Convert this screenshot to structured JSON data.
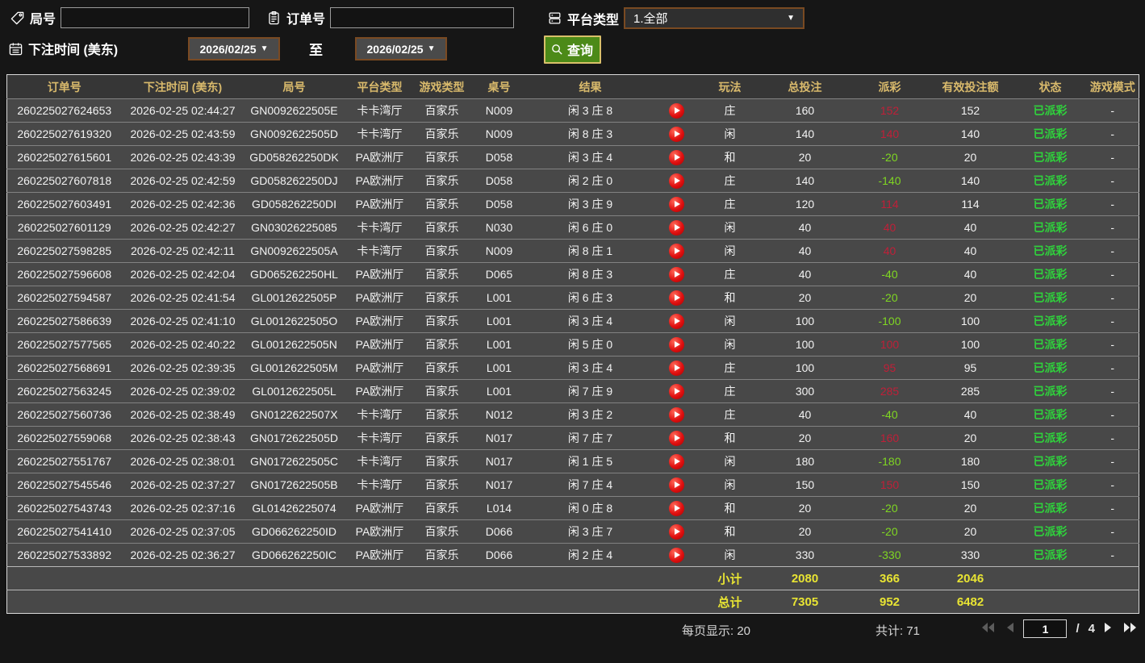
{
  "filter_bar": {
    "game_no": {
      "label": "局号",
      "value": ""
    },
    "order_no": {
      "label": "订单号",
      "value": ""
    },
    "platform_type": {
      "label": "平台类型",
      "value": "1.全部"
    },
    "bet_time": {
      "label": "下注时间 (美东)"
    },
    "date_from": "2026/02/25",
    "to_label": "至",
    "date_to": "2026/02/25",
    "search_button": "查询"
  },
  "table": {
    "headers": [
      "订单号",
      "下注时间 (美东)",
      "局号",
      "平台类型",
      "游戏类型",
      "桌号",
      "结果",
      "",
      "玩法",
      "总投注",
      "派彩",
      "有效投注额",
      "状态",
      "游戏模式"
    ],
    "rows": [
      {
        "order": "260225027624653",
        "time": "2026-02-25 02:44:27",
        "game_no": "GN0092622505E",
        "platform": "卡卡湾厅",
        "game_type": "百家乐",
        "table_no": "N009",
        "result": "闲 3 庄 8",
        "play": "庄",
        "total_bet": "160",
        "payout": "152",
        "valid_bet": "152",
        "status": "已派彩",
        "mode": "-"
      },
      {
        "order": "260225027619320",
        "time": "2026-02-25 02:43:59",
        "game_no": "GN0092622505D",
        "platform": "卡卡湾厅",
        "game_type": "百家乐",
        "table_no": "N009",
        "result": "闲 8 庄 3",
        "play": "闲",
        "total_bet": "140",
        "payout": "140",
        "valid_bet": "140",
        "status": "已派彩",
        "mode": "-"
      },
      {
        "order": "260225027615601",
        "time": "2026-02-25 02:43:39",
        "game_no": "GD058262250DK",
        "platform": "PA欧洲厅",
        "game_type": "百家乐",
        "table_no": "D058",
        "result": "闲 3 庄 4",
        "play": "和",
        "total_bet": "20",
        "payout": "-20",
        "valid_bet": "20",
        "status": "已派彩",
        "mode": "-"
      },
      {
        "order": "260225027607818",
        "time": "2026-02-25 02:42:59",
        "game_no": "GD058262250DJ",
        "platform": "PA欧洲厅",
        "game_type": "百家乐",
        "table_no": "D058",
        "result": "闲 2 庄 0",
        "play": "庄",
        "total_bet": "140",
        "payout": "-140",
        "valid_bet": "140",
        "status": "已派彩",
        "mode": "-"
      },
      {
        "order": "260225027603491",
        "time": "2026-02-25 02:42:36",
        "game_no": "GD058262250DI",
        "platform": "PA欧洲厅",
        "game_type": "百家乐",
        "table_no": "D058",
        "result": "闲 3 庄 9",
        "play": "庄",
        "total_bet": "120",
        "payout": "114",
        "valid_bet": "114",
        "status": "已派彩",
        "mode": "-"
      },
      {
        "order": "260225027601129",
        "time": "2026-02-25 02:42:27",
        "game_no": "GN03026225085",
        "platform": "卡卡湾厅",
        "game_type": "百家乐",
        "table_no": "N030",
        "result": "闲 6 庄 0",
        "play": "闲",
        "total_bet": "40",
        "payout": "40",
        "valid_bet": "40",
        "status": "已派彩",
        "mode": "-"
      },
      {
        "order": "260225027598285",
        "time": "2026-02-25 02:42:11",
        "game_no": "GN0092622505A",
        "platform": "卡卡湾厅",
        "game_type": "百家乐",
        "table_no": "N009",
        "result": "闲 8 庄 1",
        "play": "闲",
        "total_bet": "40",
        "payout": "40",
        "valid_bet": "40",
        "status": "已派彩",
        "mode": "-"
      },
      {
        "order": "260225027596608",
        "time": "2026-02-25 02:42:04",
        "game_no": "GD065262250HL",
        "platform": "PA欧洲厅",
        "game_type": "百家乐",
        "table_no": "D065",
        "result": "闲 8 庄 3",
        "play": "庄",
        "total_bet": "40",
        "payout": "-40",
        "valid_bet": "40",
        "status": "已派彩",
        "mode": "-"
      },
      {
        "order": "260225027594587",
        "time": "2026-02-25 02:41:54",
        "game_no": "GL0012622505P",
        "platform": "PA欧洲厅",
        "game_type": "百家乐",
        "table_no": "L001",
        "result": "闲 6 庄 3",
        "play": "和",
        "total_bet": "20",
        "payout": "-20",
        "valid_bet": "20",
        "status": "已派彩",
        "mode": "-"
      },
      {
        "order": "260225027586639",
        "time": "2026-02-25 02:41:10",
        "game_no": "GL0012622505O",
        "platform": "PA欧洲厅",
        "game_type": "百家乐",
        "table_no": "L001",
        "result": "闲 3 庄 4",
        "play": "闲",
        "total_bet": "100",
        "payout": "-100",
        "valid_bet": "100",
        "status": "已派彩",
        "mode": "-"
      },
      {
        "order": "260225027577565",
        "time": "2026-02-25 02:40:22",
        "game_no": "GL0012622505N",
        "platform": "PA欧洲厅",
        "game_type": "百家乐",
        "table_no": "L001",
        "result": "闲 5 庄 0",
        "play": "闲",
        "total_bet": "100",
        "payout": "100",
        "valid_bet": "100",
        "status": "已派彩",
        "mode": "-"
      },
      {
        "order": "260225027568691",
        "time": "2026-02-25 02:39:35",
        "game_no": "GL0012622505M",
        "platform": "PA欧洲厅",
        "game_type": "百家乐",
        "table_no": "L001",
        "result": "闲 3 庄 4",
        "play": "庄",
        "total_bet": "100",
        "payout": "95",
        "valid_bet": "95",
        "status": "已派彩",
        "mode": "-"
      },
      {
        "order": "260225027563245",
        "time": "2026-02-25 02:39:02",
        "game_no": "GL0012622505L",
        "platform": "PA欧洲厅",
        "game_type": "百家乐",
        "table_no": "L001",
        "result": "闲 7 庄 9",
        "play": "庄",
        "total_bet": "300",
        "payout": "285",
        "valid_bet": "285",
        "status": "已派彩",
        "mode": "-"
      },
      {
        "order": "260225027560736",
        "time": "2026-02-25 02:38:49",
        "game_no": "GN0122622507X",
        "platform": "卡卡湾厅",
        "game_type": "百家乐",
        "table_no": "N012",
        "result": "闲 3 庄 2",
        "play": "庄",
        "total_bet": "40",
        "payout": "-40",
        "valid_bet": "40",
        "status": "已派彩",
        "mode": "-"
      },
      {
        "order": "260225027559068",
        "time": "2026-02-25 02:38:43",
        "game_no": "GN0172622505D",
        "platform": "卡卡湾厅",
        "game_type": "百家乐",
        "table_no": "N017",
        "result": "闲 7 庄 7",
        "play": "和",
        "total_bet": "20",
        "payout": "160",
        "valid_bet": "20",
        "status": "已派彩",
        "mode": "-"
      },
      {
        "order": "260225027551767",
        "time": "2026-02-25 02:38:01",
        "game_no": "GN0172622505C",
        "platform": "卡卡湾厅",
        "game_type": "百家乐",
        "table_no": "N017",
        "result": "闲 1 庄 5",
        "play": "闲",
        "total_bet": "180",
        "payout": "-180",
        "valid_bet": "180",
        "status": "已派彩",
        "mode": "-"
      },
      {
        "order": "260225027545546",
        "time": "2026-02-25 02:37:27",
        "game_no": "GN0172622505B",
        "platform": "卡卡湾厅",
        "game_type": "百家乐",
        "table_no": "N017",
        "result": "闲 7 庄 4",
        "play": "闲",
        "total_bet": "150",
        "payout": "150",
        "valid_bet": "150",
        "status": "已派彩",
        "mode": "-"
      },
      {
        "order": "260225027543743",
        "time": "2026-02-25 02:37:16",
        "game_no": "GL01426225074",
        "platform": "PA欧洲厅",
        "game_type": "百家乐",
        "table_no": "L014",
        "result": "闲 0 庄 8",
        "play": "和",
        "total_bet": "20",
        "payout": "-20",
        "valid_bet": "20",
        "status": "已派彩",
        "mode": "-"
      },
      {
        "order": "260225027541410",
        "time": "2026-02-25 02:37:05",
        "game_no": "GD066262250ID",
        "platform": "PA欧洲厅",
        "game_type": "百家乐",
        "table_no": "D066",
        "result": "闲 3 庄 7",
        "play": "和",
        "total_bet": "20",
        "payout": "-20",
        "valid_bet": "20",
        "status": "已派彩",
        "mode": "-"
      },
      {
        "order": "260225027533892",
        "time": "2026-02-25 02:36:27",
        "game_no": "GD066262250IC",
        "platform": "PA欧洲厅",
        "game_type": "百家乐",
        "table_no": "D066",
        "result": "闲 2 庄 4",
        "play": "闲",
        "total_bet": "330",
        "payout": "-330",
        "valid_bet": "330",
        "status": "已派彩",
        "mode": "-"
      }
    ],
    "subtotal": {
      "label": "小计",
      "total_bet": "2080",
      "payout": "366",
      "valid_bet": "2046"
    },
    "grand_total": {
      "label": "总计",
      "total_bet": "7305",
      "payout": "952",
      "valid_bet": "6482"
    }
  },
  "pagination": {
    "per_page_label": "每页显示:",
    "per_page_value": "20",
    "total_label": "共计:",
    "total_value": "71",
    "current_page": "1",
    "page_separator": "/",
    "total_pages": "4"
  },
  "colors": {
    "header_text": "#d9ba6c",
    "payout_win_red": "#c01f38",
    "payout_loss_green": "#7fd622",
    "status_paid_green": "#2fd23c",
    "totals_yellow": "#e8e433",
    "search_button_green": "#4c8a18",
    "accent_border_brown": "#7a4a22"
  }
}
